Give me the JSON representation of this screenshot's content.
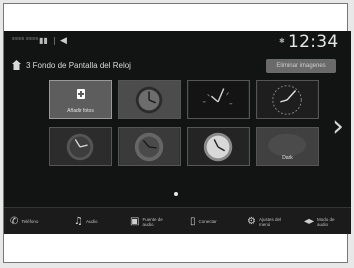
{
  "status": {
    "mini_text": "≡≡≡≡ ≡≡≡≡",
    "signal": "▮▮",
    "volume_icon": "speaker-icon",
    "gps_icon": "✱",
    "time": "12:34"
  },
  "header": {
    "title": "3 Fondo de Pantalla del Reloj",
    "delete_all": "Eliminar imagenes"
  },
  "tiles": {
    "add_label": "Añadir fotos",
    "last_label": "Dark"
  },
  "bottom": {
    "phone": "Teléfono",
    "audio": "Audio",
    "audio_source": "Fuente de audio",
    "connect": "Conectar",
    "settings": "Ajustes del menú",
    "audio_mode": "Modo de audio"
  }
}
